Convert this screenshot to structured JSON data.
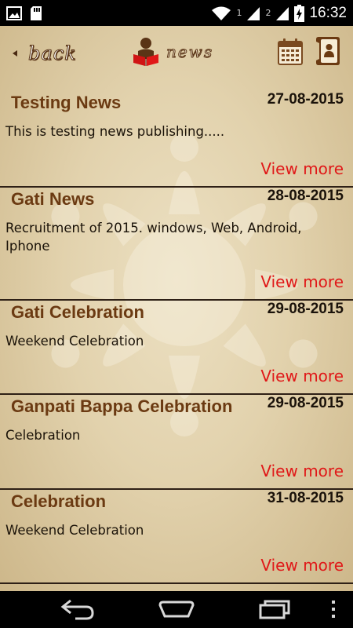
{
  "status_bar": {
    "time": "16:32",
    "sim1": "1",
    "sim2": "2"
  },
  "header": {
    "back_label": "back",
    "title": "news"
  },
  "news": [
    {
      "title": "Testing News",
      "date": "27-08-2015",
      "description": "This is testing news publishing.....",
      "more": "View more"
    },
    {
      "title": "Gati News",
      "date": "28-08-2015",
      "description": "Recruitment of 2015. windows, Web, Android, Iphone",
      "more": "View more"
    },
    {
      "title": "Gati Celebration",
      "date": "29-08-2015",
      "description": "Weekend Celebration",
      "more": "View more"
    },
    {
      "title": "Ganpati Bappa Celebration",
      "date": "29-08-2015",
      "description": "Celebration",
      "more": "View more"
    },
    {
      "title": "Celebration",
      "date": "31-08-2015",
      "description": "Weekend Celebration",
      "more": "View more"
    }
  ],
  "colors": {
    "title_brown": "#6b3a12",
    "view_more_red": "#e01818",
    "background": "#e2d2ad"
  },
  "icons": [
    "image-icon",
    "sd-card-icon",
    "wifi-icon",
    "signal-icon",
    "battery-icon",
    "back-arrow-icon",
    "reader-icon",
    "calendar-icon",
    "profile-icon",
    "nav-back-icon",
    "nav-home-icon",
    "nav-recents-icon",
    "nav-menu-icon"
  ]
}
